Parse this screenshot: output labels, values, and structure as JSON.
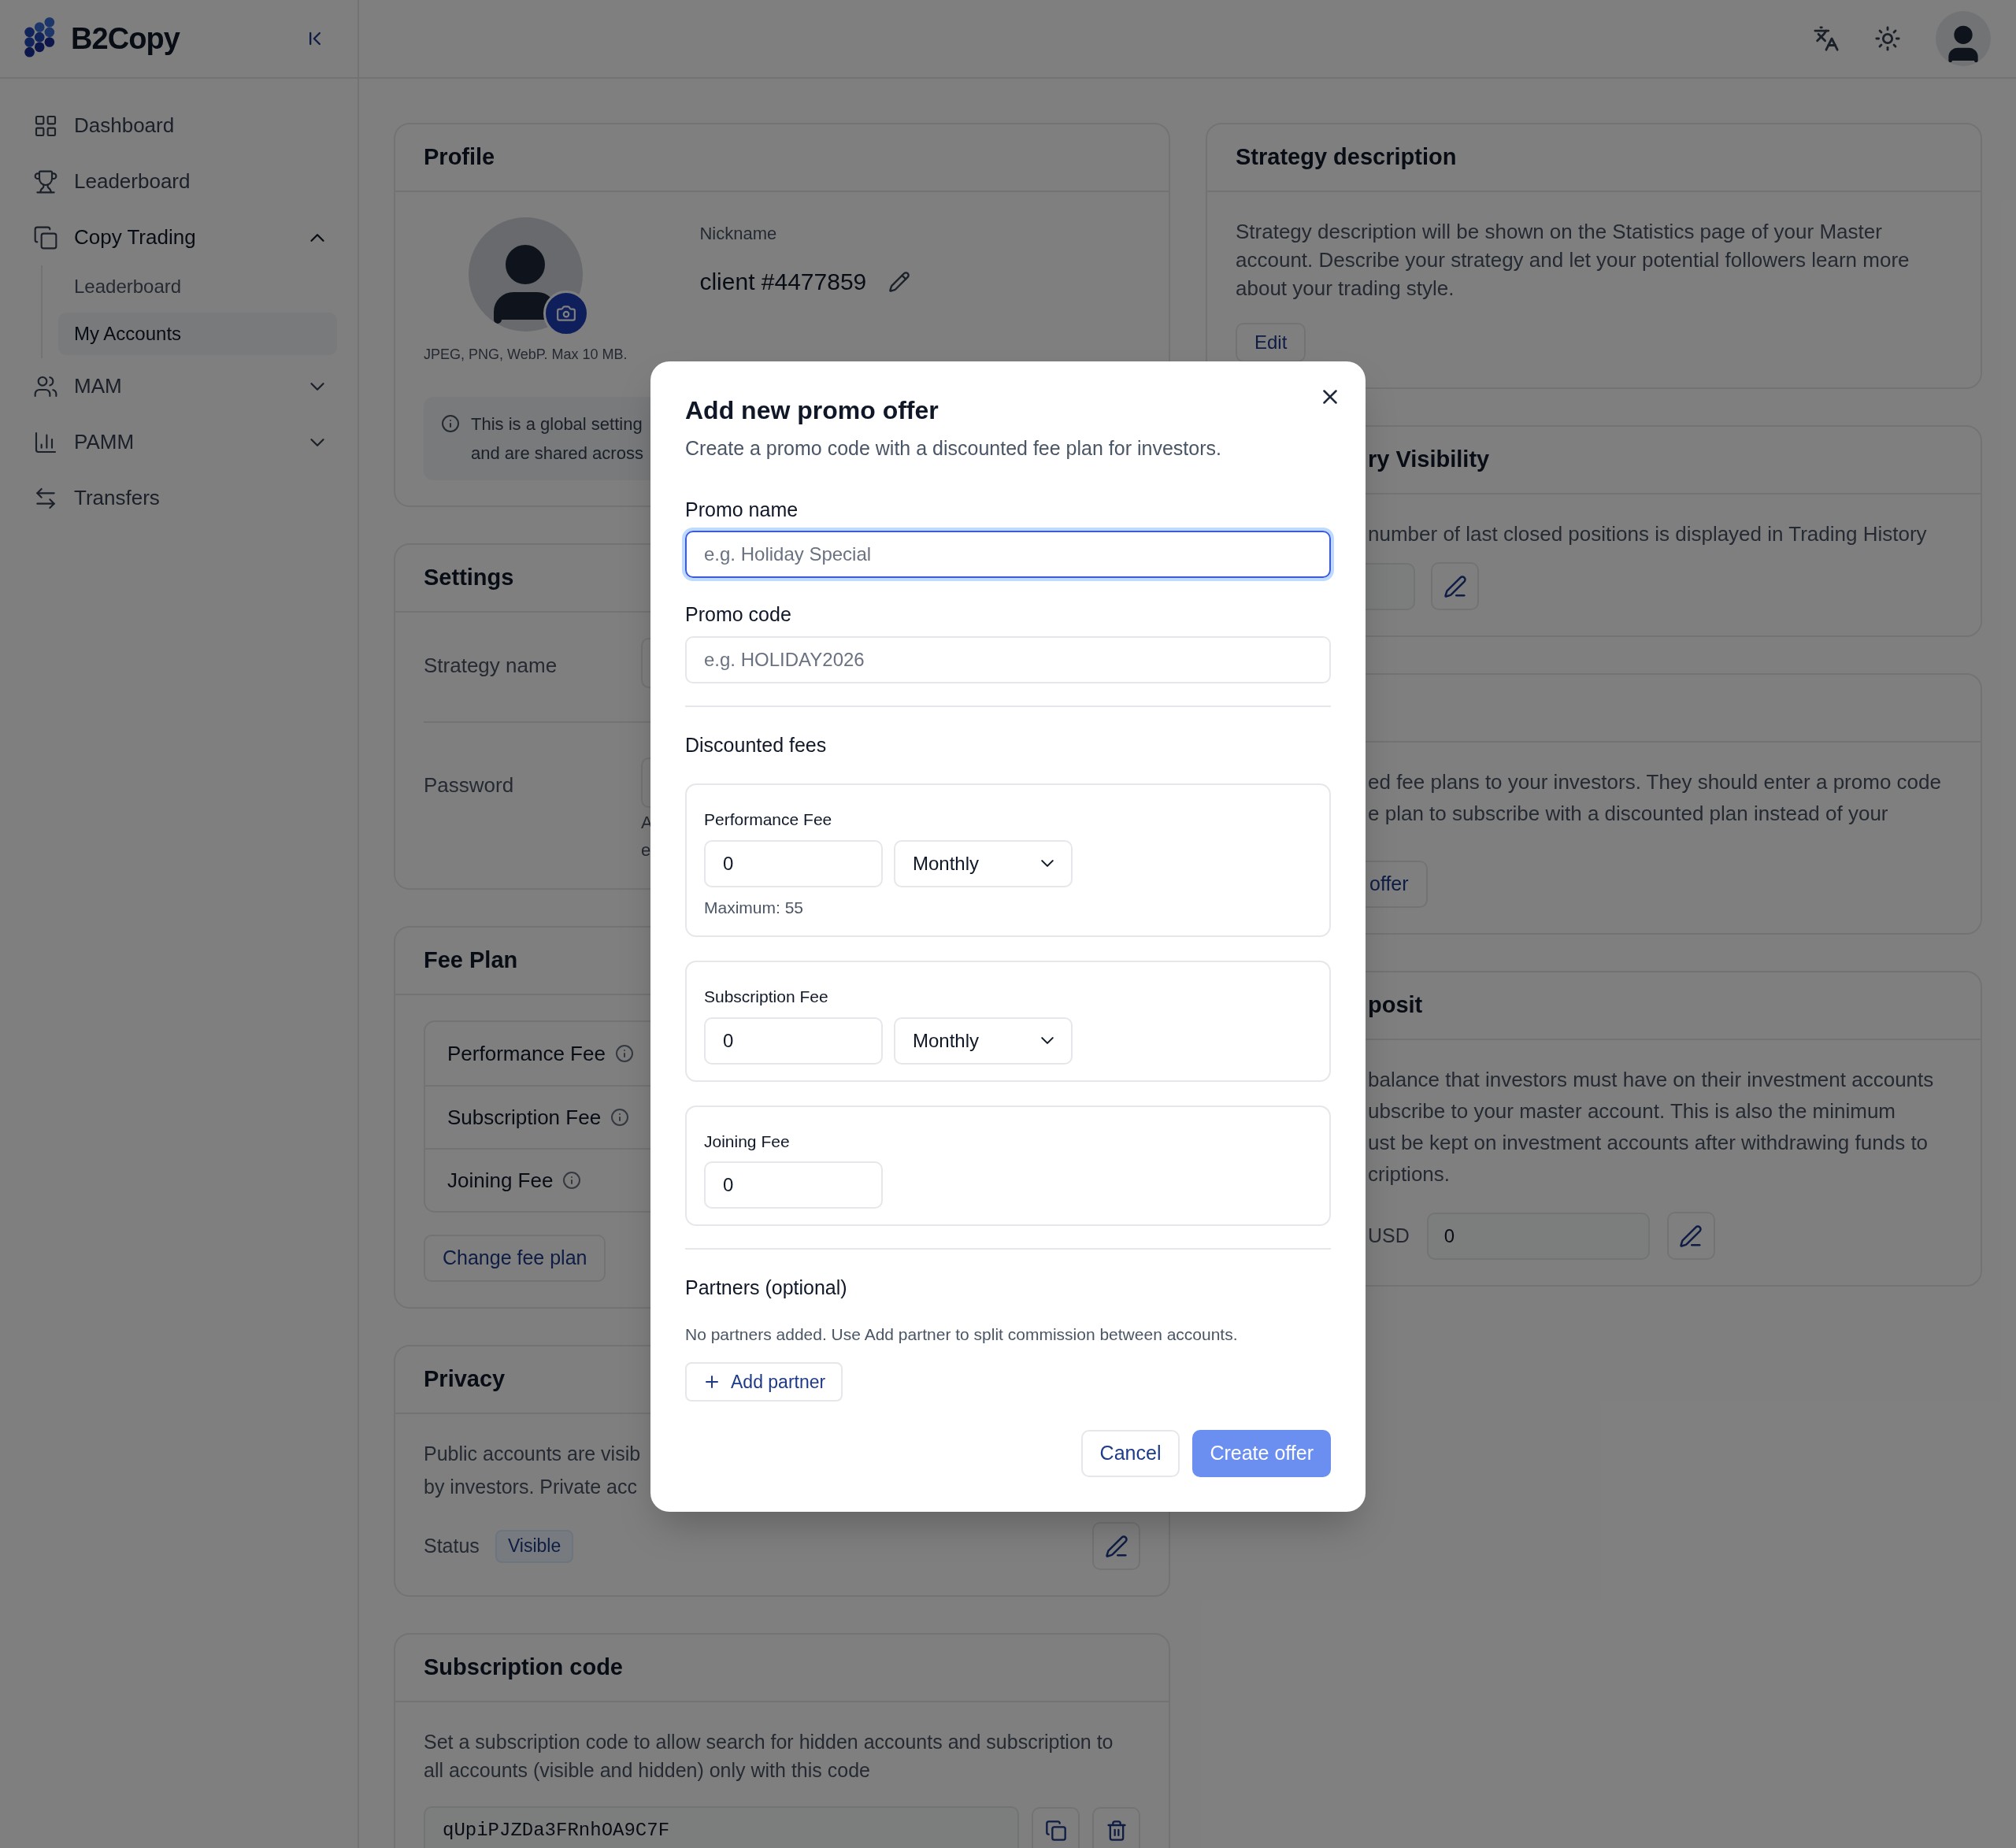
{
  "sidebar": {
    "logo": "B2Copy",
    "items": [
      {
        "label": "Dashboard"
      },
      {
        "label": "Leaderboard"
      },
      {
        "label": "Copy Trading",
        "expanded": true,
        "children": [
          {
            "label": "Leaderboard",
            "selected": false
          },
          {
            "label": "My Accounts",
            "selected": true
          }
        ]
      },
      {
        "label": "MAM",
        "expanded": false
      },
      {
        "label": "PAMM",
        "expanded": false
      },
      {
        "label": "Transfers"
      }
    ]
  },
  "profile": {
    "title": "Profile",
    "avatar_hint": "JPEG, PNG, WebP. Max 10 MB.",
    "nickname_label": "Nickname",
    "nickname": "client #4477859",
    "notice": [
      "This is a global setting",
      "and are shared across"
    ]
  },
  "settings": {
    "title": "Settings",
    "rows": [
      {
        "label": "Strategy name",
        "hint": []
      },
      {
        "label": "Password",
        "hint": [
          "A",
          "e"
        ]
      }
    ]
  },
  "fee_plan": {
    "title": "Fee Plan",
    "rows": [
      "Performance Fee",
      "Subscription Fee",
      "Joining Fee"
    ],
    "button": "Change fee plan"
  },
  "privacy": {
    "title": "Privacy",
    "text": [
      "Public accounts are visib",
      "by investors. Private acc"
    ],
    "status_label": "Status",
    "status": "Visible"
  },
  "subscription_code": {
    "title": "Subscription code",
    "text": "Set a subscription code to allow search for hidden accounts and subscription to all accounts (visible and hidden) only with this code",
    "code": "qUpiPJZDa3FRnhOA9C7F"
  },
  "strategy_description": {
    "title": "Strategy description",
    "text": "Strategy description will be shown on the Statistics page of your Master account. Describe your strategy and let your potential followers learn more about your trading style.",
    "button": "Edit"
  },
  "history_visibility": {
    "title": "ry Visibility",
    "text": "number of last closed positions is displayed in Trading History"
  },
  "promo_offers": {
    "text": [
      "ed fee plans to your investors. They should enter a promo code",
      "e plan to subscribe with a discounted plan instead of your"
    ],
    "button": "offer"
  },
  "min_deposit": {
    "title": "posit",
    "text": [
      "balance that investors must have on their investment accounts",
      "ubscribe to your master account. This is also the minimum",
      "ust be kept on investment accounts after withdrawing funds to",
      "criptions."
    ],
    "currency": "USD",
    "value": "0"
  },
  "modal": {
    "title": "Add new promo offer",
    "subtitle": "Create a promo code with a discounted fee plan for investors.",
    "fields": [
      {
        "label": "Promo name",
        "placeholder": "e.g. Holiday Special",
        "focused": true
      },
      {
        "label": "Promo code",
        "placeholder": "e.g. HOLIDAY2026",
        "focused": false
      }
    ],
    "fees_title": "Discounted fees",
    "fees": [
      {
        "label": "Performance Fee",
        "value": "0",
        "period": "Monthly",
        "hint": "Maximum: 55"
      },
      {
        "label": "Subscription Fee",
        "value": "0",
        "period": "Monthly"
      },
      {
        "label": "Joining Fee",
        "value": "0"
      }
    ],
    "partners_title": "Partners (optional)",
    "partners_text": "No partners added. Use Add partner to split commission between accounts.",
    "add_partner": "Add partner",
    "buttons": [
      {
        "label": "Cancel",
        "kind": "secondary"
      },
      {
        "label": "Create offer",
        "kind": "primary"
      }
    ]
  }
}
